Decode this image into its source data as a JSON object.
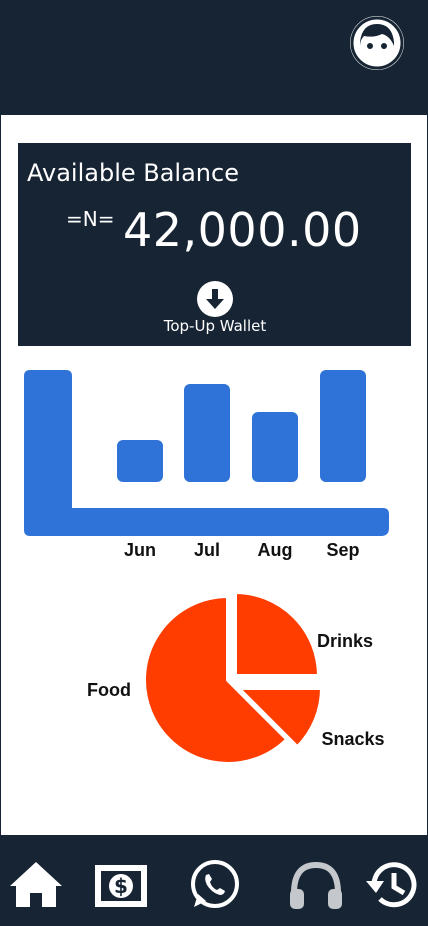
{
  "header": {
    "avatar_icon": "face-icon"
  },
  "balance": {
    "title": "Available Balance",
    "currency": "=N=",
    "amount": "42,000.00",
    "topup_label": "Top-Up Wallet",
    "topup_icon": "arrow-down-circle-icon"
  },
  "colors": {
    "dark": "#172434",
    "bar": "#2f73d8",
    "pie": "#ff3d00"
  },
  "chart_data": [
    {
      "type": "bar",
      "categories": [
        "Jun",
        "Jul",
        "Aug",
        "Sep"
      ],
      "values": [
        3,
        7,
        5,
        8
      ],
      "title": "",
      "xlabel": "",
      "ylabel": ""
    },
    {
      "type": "pie",
      "categories": [
        "Drinks",
        "Snacks",
        "Food"
      ],
      "values": [
        25,
        12.5,
        62.5
      ],
      "title": ""
    }
  ],
  "bottom_nav": {
    "items": [
      {
        "icon": "home-icon"
      },
      {
        "icon": "money-icon"
      },
      {
        "icon": "whatsapp-icon"
      },
      {
        "icon": "headphones-icon"
      },
      {
        "icon": "history-icon"
      }
    ]
  }
}
